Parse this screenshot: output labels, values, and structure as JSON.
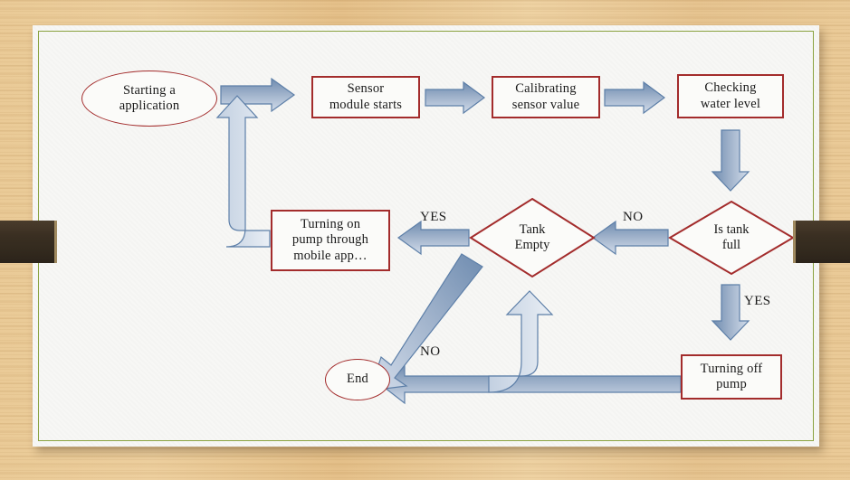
{
  "slide": {
    "background_color": "#e7c48f",
    "panel_color": "#f7f7f5",
    "panel_border_color": "#8aa23f",
    "clamp_color": "#33291e",
    "shape_border_color": "#a32c2c",
    "arrow_fill_top": "#7b96b8",
    "arrow_fill_bottom": "#cdd9e8",
    "arrow_outline_color": "#5d7fa8"
  },
  "diagram": {
    "type": "flowchart",
    "title": "",
    "nodes": [
      {
        "id": "start",
        "shape": "ellipse",
        "label": "Starting a\napplication",
        "line1": "Starting a",
        "line2": "application"
      },
      {
        "id": "sensor",
        "shape": "rectangle",
        "label": "Sensor\nmodule starts",
        "line1": "Sensor",
        "line2": "module starts"
      },
      {
        "id": "calibrate",
        "shape": "rectangle",
        "label": "Calibrating\nsensor value",
        "line1": "Calibrating",
        "line2": "sensor value"
      },
      {
        "id": "checklevel",
        "shape": "rectangle",
        "label": "Checking\nwater level",
        "line1": "Checking",
        "line2": "water level"
      },
      {
        "id": "istankfull",
        "shape": "diamond",
        "label": "Is tank\nfull",
        "line1": "Is tank",
        "line2": "full"
      },
      {
        "id": "tankempty",
        "shape": "diamond",
        "label": "Tank\nEmpty",
        "line1": "Tank",
        "line2": "Empty"
      },
      {
        "id": "turnonpump",
        "shape": "rectangle",
        "label": "Turning on\npump through\nmobile app…",
        "line1": "Turning on",
        "line2": "pump through",
        "line3": "mobile app…"
      },
      {
        "id": "turnoffpump",
        "shape": "rectangle",
        "label": "Turning off\npump",
        "line1": "Turning off",
        "line2": "pump"
      },
      {
        "id": "end",
        "shape": "ellipse",
        "label": "End",
        "line1": "End"
      }
    ],
    "edges": [
      {
        "id": "e1",
        "from": "start",
        "to": "sensor",
        "label": "",
        "direction": "right"
      },
      {
        "id": "e2",
        "from": "sensor",
        "to": "calibrate",
        "label": "",
        "direction": "right"
      },
      {
        "id": "e3",
        "from": "calibrate",
        "to": "checklevel",
        "label": "",
        "direction": "right"
      },
      {
        "id": "e4",
        "from": "checklevel",
        "to": "istankfull",
        "label": "",
        "direction": "down"
      },
      {
        "id": "e5",
        "from": "istankfull",
        "to": "tankempty",
        "label": "NO",
        "direction": "left"
      },
      {
        "id": "e6",
        "from": "tankempty",
        "to": "turnonpump",
        "label": "YES",
        "direction": "left"
      },
      {
        "id": "e7",
        "from": "turnonpump",
        "to": "sensor",
        "label": "",
        "direction": "elbow-up-right"
      },
      {
        "id": "e8",
        "from": "istankfull",
        "to": "turnoffpump",
        "label": "YES",
        "direction": "down"
      },
      {
        "id": "e9",
        "from": "turnoffpump",
        "to": "end",
        "label": "",
        "direction": "left"
      },
      {
        "id": "e10",
        "from": "turnoffpump",
        "to": "tankempty",
        "label": "",
        "direction": "elbow-left-up"
      },
      {
        "id": "e11",
        "from": "tankempty",
        "to": "end",
        "label": "NO",
        "direction": "diagonal-down-left"
      }
    ],
    "edge_labels": {
      "no_tankfull": "NO",
      "yes_tankempty": "YES",
      "yes_tankfull": "YES",
      "no_tankempty": "NO"
    }
  }
}
